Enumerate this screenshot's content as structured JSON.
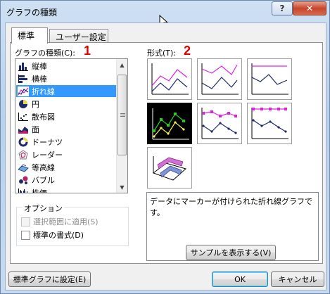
{
  "window": {
    "title": "グラフの種類",
    "help_label": "?",
    "close_label": "✕"
  },
  "tabs": [
    {
      "label": "標準",
      "active": true
    },
    {
      "label": "ユーザー設定",
      "active": false
    }
  ],
  "chart_type_label": "グラフの種類(C):",
  "marker_1": "1",
  "marker_2": "2",
  "subtype_label": "形式(T):",
  "chart_types": [
    {
      "label": "縦棒",
      "icon": "column-chart-icon",
      "selected": false
    },
    {
      "label": "横棒",
      "icon": "bar-chart-icon",
      "selected": false
    },
    {
      "label": "折れ線",
      "icon": "line-chart-icon",
      "selected": true
    },
    {
      "label": "円",
      "icon": "pie-chart-icon",
      "selected": false
    },
    {
      "label": "散布図",
      "icon": "scatter-chart-icon",
      "selected": false
    },
    {
      "label": "面",
      "icon": "area-chart-icon",
      "selected": false
    },
    {
      "label": "ドーナツ",
      "icon": "doughnut-chart-icon",
      "selected": false
    },
    {
      "label": "レーダー",
      "icon": "radar-chart-icon",
      "selected": false
    },
    {
      "label": "等高線",
      "icon": "surface-chart-icon",
      "selected": false
    },
    {
      "label": "バブル",
      "icon": "bubble-chart-icon",
      "selected": false
    },
    {
      "label": "株価",
      "icon": "stock-chart-icon",
      "selected": false
    }
  ],
  "options": {
    "title": "オプション",
    "apply_to_selection": "選択範囲に適用(S)",
    "default_format": "標準の書式(D)"
  },
  "description": "データにマーカーが付けられた折れ線グラフです。",
  "buttons": {
    "preview": "サンプルを表示する(V)",
    "set_default": "標準グラフに設定(E)",
    "ok": "OK",
    "cancel": "キャンセル"
  },
  "colors": {
    "selection": "#3399ff",
    "marker_red": "#e00000",
    "series_magenta": "#e020e0",
    "series_navy": "#1f2a6b"
  }
}
